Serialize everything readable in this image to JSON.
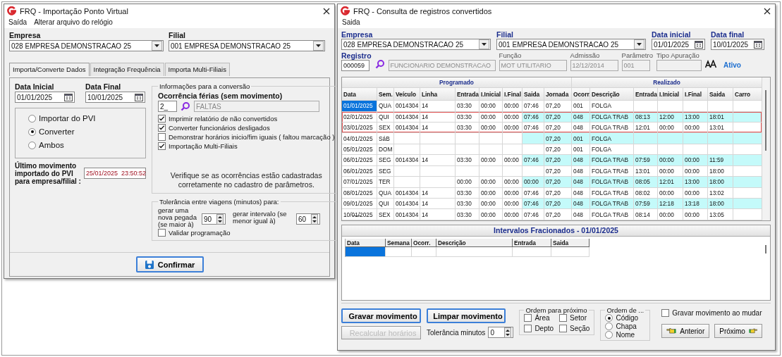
{
  "left_window": {
    "title": "FRQ - Importação Ponto Virtual",
    "menu": [
      "Saída",
      "Alterar arquivo do relógio"
    ],
    "empresa": {
      "label": "Empresa",
      "value": "028 EMPRESA DEMONSTRACAO 25"
    },
    "filial": {
      "label": "Filial",
      "value": "001 EMPRESA DEMONSTRACAO 25"
    },
    "tabs": [
      {
        "label": "Importa/Converte Dados",
        "selected": true
      },
      {
        "label": "Integração Frequência",
        "selected": false
      },
      {
        "label": "Importa Multi-Filiais",
        "selected": false
      }
    ],
    "data_inicial": {
      "label": "Data Inicial",
      "value": "01/01/2025"
    },
    "data_final": {
      "label": "Data Final",
      "value": "10/01/2025"
    },
    "mode_options": [
      {
        "label": "Importar do PVI",
        "selected": false
      },
      {
        "label": "Converter",
        "selected": true
      },
      {
        "label": "Ambos",
        "selected": false
      }
    ],
    "last_import": {
      "label": "Último movimento importado do PVI para empresa/filial :",
      "value": "25/01/2025  23:50:52"
    },
    "conversion_group": {
      "title": "Informações para a conversão",
      "occurrence_label": "Ocorrência férias (sem movimento)",
      "occurrence_code": "2_",
      "occurrence_name": "FALTAS",
      "options": [
        {
          "label": "Imprimir relatório de não convertidos",
          "checked": true
        },
        {
          "label": "Converter funcionários desligados",
          "checked": true
        },
        {
          "label": "Demonstrar horários inicio/fim iguais ( faltou marcação )",
          "checked": false
        },
        {
          "label": "Importação Multi-Filiais",
          "checked": true
        }
      ],
      "note": "Verifique se as ocorrências estão cadastradas corretamente  no cadastro de parâmetros."
    },
    "tolerance_group": {
      "title": "Tolerância entre viagens (minutos) para:",
      "new_entry_label": "gerar uma nova pegada (se maior à)",
      "new_entry_value": "90",
      "interval_label": "gerar intervalo (se menor igual à)",
      "interval_value": "60",
      "validate": {
        "label": "Validar programação",
        "checked": false
      }
    },
    "confirm_button": "Confirmar"
  },
  "right_window": {
    "title": "FRQ - Consulta de registros convertidos",
    "menu": [
      "Saida"
    ],
    "top_fields": [
      {
        "label": "Empresa",
        "value": "028 EMPRESA DEMONSTRACAO 25",
        "kind": "combo"
      },
      {
        "label": "Filial",
        "value": "001 EMPRESA DEMONSTRACAO 25",
        "kind": "combo"
      },
      {
        "label": "Data inicial",
        "value": "01/01/2025",
        "kind": "date"
      },
      {
        "label": "Data final",
        "value": "10/01/2025",
        "kind": "date"
      }
    ],
    "registro": {
      "label": "Registro",
      "value": "000059"
    },
    "employee_name": "FUNCIONARIO DEMONSTRACAO",
    "info_fields": [
      {
        "label": "Função",
        "value": "MOT UTILITARIO"
      },
      {
        "label": "Admissão",
        "value": "12/12/2014"
      },
      {
        "label": "Parâmetro",
        "value": "001"
      },
      {
        "label": "Tipo Apuração"
      }
    ],
    "status": "Ativo",
    "main_table": {
      "groups": [
        {
          "label": "Programado",
          "columns": [
            {
              "label": "Data",
              "tinted": false
            },
            {
              "label": "Sem.",
              "tinted": false
            },
            {
              "label": "Veículo",
              "tinted": false
            },
            {
              "label": "Linha",
              "tinted": false
            },
            {
              "label": "Entrada",
              "tinted": false
            },
            {
              "label": "I.Inicial",
              "tinted": false
            },
            {
              "label": "I.Final",
              "tinted": false
            },
            {
              "label": "Saida",
              "tinted": true
            },
            {
              "label": "Jornada",
              "tinted": true
            }
          ]
        },
        {
          "label": "Realizado",
          "columns": [
            {
              "label": "Ocorr.",
              "tinted": true
            },
            {
              "label": "Descrição",
              "tinted": true
            },
            {
              "label": "Entrada",
              "tinted": true
            },
            {
              "label": "I.Inicial",
              "tinted": true
            },
            {
              "label": "I.Final",
              "tinted": true
            },
            {
              "label": "Saida",
              "tinted": true
            },
            {
              "label": "Carro",
              "tinted": true
            }
          ]
        }
      ],
      "rows": [
        {
          "selected": true,
          "highlighted": false,
          "marked": false,
          "programado": {
            "data": "01/01/2025",
            "sem": "QUA",
            "veiculo": "0014304",
            "linha": "14",
            "entrada": "03:30",
            "i_inicial": "00:00",
            "i_final": "00:00",
            "saida": "07:46",
            "jornada": "07,20"
          },
          "realizado": {
            "ocorr": "001",
            "descricao": "FOLGA"
          }
        },
        {
          "selected": false,
          "highlighted": true,
          "marked": true,
          "programado": {
            "data": "02/01/2025",
            "sem": "QUI",
            "veiculo": "0014304",
            "linha": "14",
            "entrada": "03:30",
            "i_inicial": "00:00",
            "i_final": "00:00",
            "saida": "07:46",
            "jornada": "07,20"
          },
          "realizado": {
            "ocorr": "048",
            "descricao": "FOLGA TRAB",
            "entrada": "08:13",
            "i_inicial": "12:00",
            "i_final": "13:00",
            "saida": "18:01"
          }
        },
        {
          "selected": false,
          "highlighted": false,
          "marked": true,
          "programado": {
            "data": "03/01/2025",
            "sem": "SEX",
            "veiculo": "0014304",
            "linha": "14",
            "entrada": "03:30",
            "i_inicial": "00:00",
            "i_final": "00:00",
            "saida": "07:46",
            "jornada": "07,20"
          },
          "realizado": {
            "ocorr": "048",
            "descricao": "FOLGA TRAB",
            "entrada": "12:01",
            "i_inicial": "00:00",
            "i_final": "00:00",
            "saida": "13:01"
          }
        },
        {
          "selected": false,
          "highlighted": true,
          "marked": false,
          "programado": {
            "data": "04/01/2025",
            "sem": "SáB",
            "jornada": "07,20"
          },
          "realizado": {
            "ocorr": "001",
            "descricao": "FOLGA"
          }
        },
        {
          "selected": false,
          "highlighted": false,
          "marked": false,
          "programado": {
            "data": "05/01/2025",
            "sem": "DOM",
            "jornada": "07,20"
          },
          "realizado": {
            "ocorr": "001",
            "descricao": "FOLGA"
          }
        },
        {
          "selected": false,
          "highlighted": true,
          "marked": false,
          "programado": {
            "data": "06/01/2025",
            "sem": "SEG",
            "veiculo": "0014304",
            "linha": "14",
            "entrada": "03:30",
            "i_inicial": "00:00",
            "i_final": "00:00",
            "saida": "07:46",
            "jornada": "07,20"
          },
          "realizado": {
            "ocorr": "048",
            "descricao": "FOLGA TRAB",
            "entrada": "07:59",
            "i_inicial": "00:00",
            "i_final": "00:00",
            "saida": "11:59"
          }
        },
        {
          "selected": false,
          "highlighted": false,
          "marked": false,
          "programado": {
            "data": "06/01/2025",
            "sem": "SEG",
            "jornada": "07,20"
          },
          "realizado": {
            "ocorr": "048",
            "descricao": "FOLGA TRAB",
            "entrada": "13:01",
            "i_inicial": "00:00",
            "i_final": "00:00",
            "saida": "18:00"
          }
        },
        {
          "selected": false,
          "highlighted": true,
          "marked": false,
          "programado": {
            "data": "07/01/2025",
            "sem": "TER",
            "entrada": "00:00",
            "i_inicial": "00:00",
            "i_final": "00:00",
            "saida": "00:00",
            "jornada": "07,20"
          },
          "realizado": {
            "ocorr": "048",
            "descricao": "FOLGA TRAB",
            "entrada": "08:05",
            "i_inicial": "12:01",
            "i_final": "13:00",
            "saida": "18:00"
          }
        },
        {
          "selected": false,
          "highlighted": false,
          "marked": false,
          "programado": {
            "data": "08/01/2025",
            "sem": "QUA",
            "veiculo": "0014304",
            "linha": "14",
            "entrada": "03:30",
            "i_inicial": "00:00",
            "i_final": "00:00",
            "saida": "07:46",
            "jornada": "07,20"
          },
          "realizado": {
            "ocorr": "048",
            "descricao": "FOLGA TRAB",
            "entrada": "08:02",
            "i_inicial": "00:00",
            "i_final": "00:00",
            "saida": "13:02"
          }
        },
        {
          "selected": false,
          "highlighted": true,
          "marked": false,
          "programado": {
            "data": "09/01/2025",
            "sem": "QUI",
            "veiculo": "0014304",
            "linha": "14",
            "entrada": "03:30",
            "i_inicial": "00:00",
            "i_final": "00:00",
            "saida": "07:46",
            "jornada": "07,20"
          },
          "realizado": {
            "ocorr": "048",
            "descricao": "FOLGA TRAB",
            "entrada": "07:59",
            "i_inicial": "12:18",
            "i_final": "13:18",
            "saida": "18:00"
          }
        },
        {
          "selected": false,
          "highlighted": false,
          "marked": false,
          "programado": {
            "data": "10/01/2025",
            "sem": "SEX",
            "veiculo": "0014304",
            "linha": "14",
            "entrada": "03:30",
            "i_inicial": "00:00",
            "i_final": "00:00",
            "saida": "07:46",
            "jornada": "07,20"
          },
          "realizado": {
            "ocorr": "048",
            "descricao": "FOLGA TRAB",
            "entrada": "08:14",
            "i_inicial": "00:00",
            "i_final": "00:00",
            "saida": "13:05"
          }
        }
      ]
    },
    "intervals": {
      "title": "Intervalos Fracionados - 01/01/2025",
      "columns": [
        "Data",
        "Semana",
        "Ocorr.",
        "Descrição",
        "Entrada",
        "Saida"
      ],
      "rows": [
        {
          "selected": true
        }
      ]
    },
    "gravar_button": "Gravar movimento",
    "limpar_button": "Limpar movimento",
    "recalcular_button": {
      "label": "Recalcular horários",
      "disabled": true
    },
    "tolerancia": {
      "label": "Tolerância minutos",
      "value": "0"
    },
    "ordem_proximo": {
      "title": "Ordem para próximo",
      "options": [
        {
          "label": "Área",
          "checked": false
        },
        {
          "label": "Setor",
          "checked": false
        },
        {
          "label": "Depto",
          "checked": false
        },
        {
          "label": "Seção",
          "checked": false
        }
      ]
    },
    "ordem_de": {
      "title": "Ordem de ...",
      "options": [
        {
          "label": "Código",
          "selected": true
        },
        {
          "label": "Chapa",
          "selected": false
        },
        {
          "label": "Nome",
          "selected": false
        }
      ]
    },
    "save_on_change": {
      "label": "Gravar movimento ao mudar",
      "checked": false
    },
    "nav_buttons": [
      "Anterior",
      "Próximo"
    ]
  }
}
